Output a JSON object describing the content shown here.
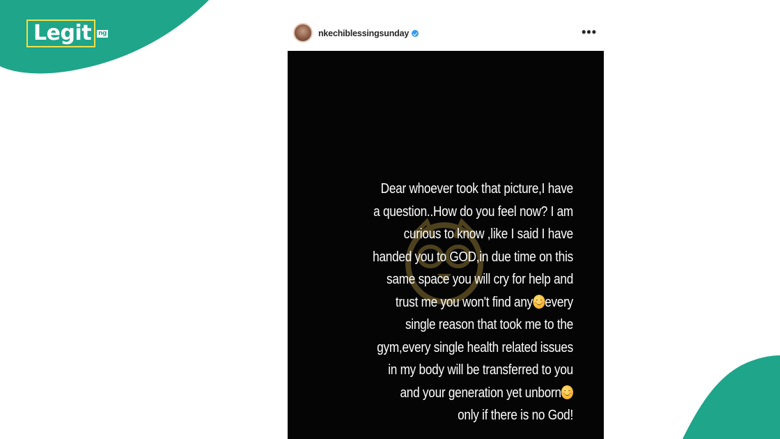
{
  "brand": {
    "logo_text": "Legit",
    "logo_suffix": "ng",
    "accent_color": "#1ea58a",
    "logo_border_color": "#f1e04a"
  },
  "post": {
    "username": "nkechiblessingsunday",
    "verified": true,
    "more_icon": "more-horizontal-icon",
    "more_label": "•••",
    "story_background": "#050505",
    "story_text_color": "#ffffff",
    "watermark_icon": "watermark-owl-icon",
    "emoji_icon": "smiling-face-icon",
    "story_lines": [
      {
        "text": "Dear whoever took that picture,I have",
        "emoji": false
      },
      {
        "text": "a question..How do you feel now? I am",
        "emoji": false
      },
      {
        "text": "curious to know ,like I said I have",
        "emoji": false
      },
      {
        "text": "handed you to GOD,in due time on this",
        "emoji": false
      },
      {
        "text": "same space you will cry for help and",
        "emoji": false
      },
      {
        "text": "trust me you won't find any",
        "emoji": true,
        "after": "every"
      },
      {
        "text": "single reason that took me to the",
        "emoji": false
      },
      {
        "text": "gym,every single health related issues",
        "emoji": false
      },
      {
        "text": "in my body will be transferred to you",
        "emoji": false
      },
      {
        "text": "and your generation yet unborn",
        "emoji": true,
        "after": ""
      },
      {
        "text": "only if there is no God!",
        "emoji": false
      }
    ]
  }
}
